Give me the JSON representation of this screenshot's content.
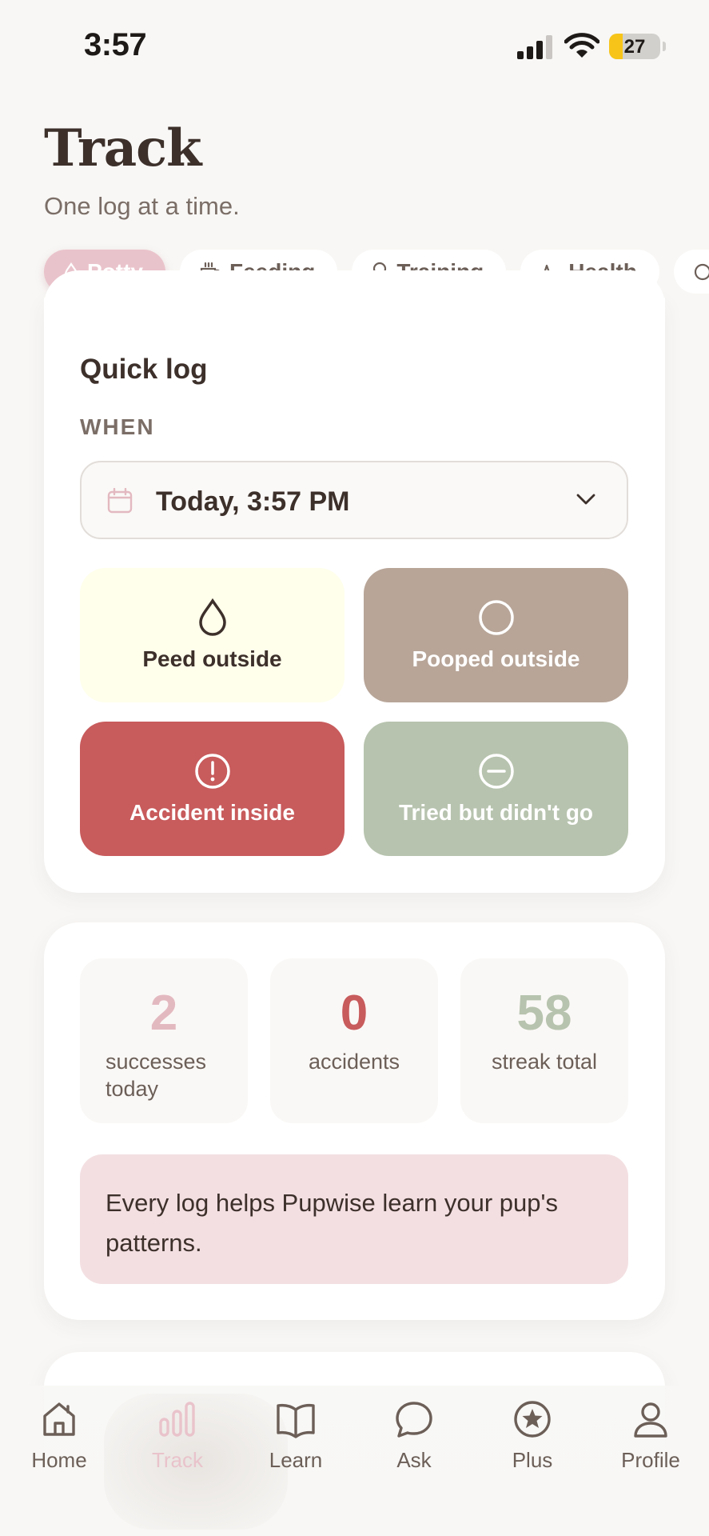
{
  "status_bar": {
    "time": "3:57",
    "battery": "27",
    "battery_level": 0.27
  },
  "header": {
    "title": "Track",
    "subtitle": "One log at a time."
  },
  "categories": [
    {
      "label": "Potty",
      "icon": "drop-icon",
      "active": true
    },
    {
      "label": "Feeding",
      "icon": "cup-icon",
      "active": false
    },
    {
      "label": "Training",
      "icon": "award-icon",
      "active": false
    },
    {
      "label": "Health",
      "icon": "pulse-icon",
      "active": false
    }
  ],
  "quick_log": {
    "title": "Quick log",
    "when_label": "WHEN",
    "when_value": "Today, 3:57 PM",
    "actions": [
      {
        "label": "Peed outside",
        "icon": "drop-icon",
        "color": "#ffffeb"
      },
      {
        "label": "Pooped outside",
        "icon": "circle-icon",
        "color": "#b8a598"
      },
      {
        "label": "Accident inside",
        "icon": "alert-circle-icon",
        "color": "#c85b5c"
      },
      {
        "label": "Tried but didn't go",
        "icon": "minus-circle-icon",
        "color": "#b7c3ae"
      }
    ]
  },
  "stats": [
    {
      "value": "2",
      "label": "successes today",
      "color": "#e3b9c0"
    },
    {
      "value": "0",
      "label": "accidents",
      "color": "#c85b5c"
    },
    {
      "value": "58",
      "label": "streak total",
      "color": "#b7c3ae"
    }
  ],
  "tip": "Every log helps Pupwise learn your pup's patterns.",
  "tabbar": [
    {
      "label": "Home",
      "icon": "home-icon",
      "active": false
    },
    {
      "label": "Track",
      "icon": "bar-chart-icon",
      "active": true
    },
    {
      "label": "Learn",
      "icon": "book-icon",
      "active": false
    },
    {
      "label": "Ask",
      "icon": "chat-bubble-icon",
      "active": false
    },
    {
      "label": "Plus",
      "icon": "star-circle-icon",
      "active": false
    },
    {
      "label": "Profile",
      "icon": "user-icon",
      "active": false
    }
  ],
  "colors": {
    "accent": "#e9c3cb",
    "text": "#3d302b",
    "muted": "#7b6e67",
    "background": "#f8f7f5"
  }
}
